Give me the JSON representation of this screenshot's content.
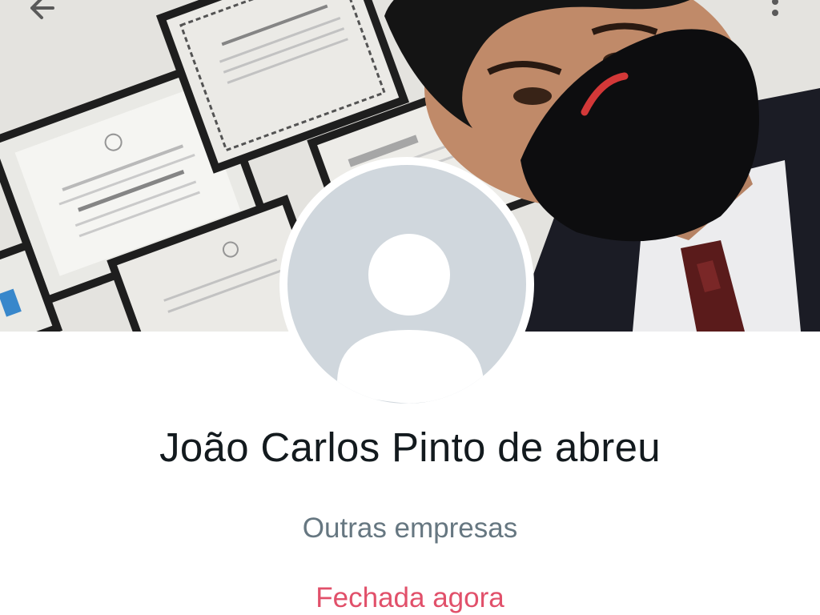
{
  "profile": {
    "name": "João Carlos Pinto de abreu",
    "category": "Outras empresas",
    "status": "Fechada agora"
  },
  "topbar": {
    "back_icon": "arrow-left-icon",
    "menu_icon": "more-vertical-icon"
  },
  "avatar": {
    "icon": "default-person-icon"
  },
  "colors": {
    "name": "#131a1e",
    "category": "#667781",
    "status_closed": "#e1506a",
    "avatar_bg": "#d0d7dd"
  }
}
